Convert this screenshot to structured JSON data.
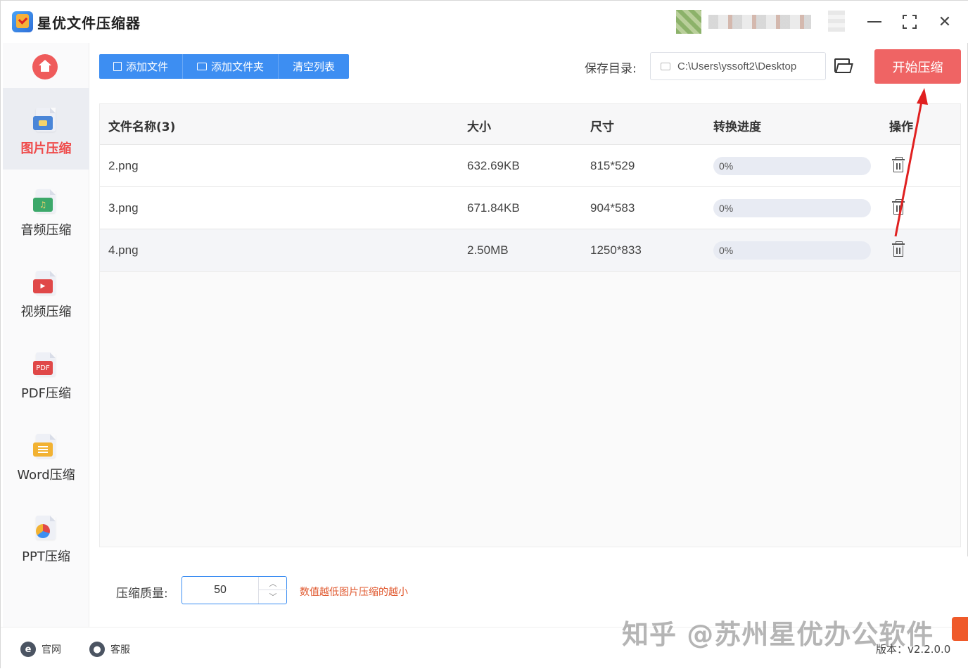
{
  "app": {
    "title": "星优文件压缩器"
  },
  "window_controls": {
    "minimize": "minimize",
    "maximize": "maximize",
    "close": "close"
  },
  "sidebar": {
    "items": [
      {
        "label": "图片压缩",
        "icon": "image-file-icon",
        "color": "#4a86d8",
        "active": true
      },
      {
        "label": "音频压缩",
        "icon": "audio-file-icon",
        "color": "#3ca86a",
        "active": false
      },
      {
        "label": "视频压缩",
        "icon": "video-file-icon",
        "color": "#e04848",
        "active": false
      },
      {
        "label": "PDF压缩",
        "icon": "pdf-file-icon",
        "color": "#e04848",
        "badge": "PDF",
        "active": false
      },
      {
        "label": "Word压缩",
        "icon": "word-file-icon",
        "color": "#f2b232",
        "active": false
      },
      {
        "label": "PPT压缩",
        "icon": "ppt-file-icon",
        "color": "#3d8ef2",
        "active": false
      }
    ]
  },
  "toolbar": {
    "add_file": "添加文件",
    "add_folder": "添加文件夹",
    "clear_list": "清空列表",
    "save_label": "保存目录:",
    "save_path": "C:\\Users\\yssoft2\\Desktop",
    "start": "开始压缩"
  },
  "table": {
    "headers": [
      "文件名称(3)",
      "大小",
      "尺寸",
      "转换进度",
      "操作"
    ],
    "rows": [
      {
        "name": "2.png",
        "size": "632.69KB",
        "dims": "815*529",
        "progress": "0%",
        "progress_value": 0
      },
      {
        "name": "3.png",
        "size": "671.84KB",
        "dims": "904*583",
        "progress": "0%",
        "progress_value": 0
      },
      {
        "name": "4.png",
        "size": "2.50MB",
        "dims": "1250*833",
        "progress": "0%",
        "progress_value": 0
      }
    ]
  },
  "quality": {
    "label": "压缩质量:",
    "value": "50",
    "hint": "数值越低图片压缩的越小"
  },
  "footer": {
    "website": "官网",
    "support": "客服",
    "version": "版本：v2.2.0.0"
  },
  "watermark": "知乎 @苏州星优办公软件",
  "colors": {
    "accent": "#3d8ef2",
    "start_button": "#ef6464",
    "active_nav": "#ef4b4b",
    "hint": "#e0582e",
    "arrow": "#e02020"
  }
}
